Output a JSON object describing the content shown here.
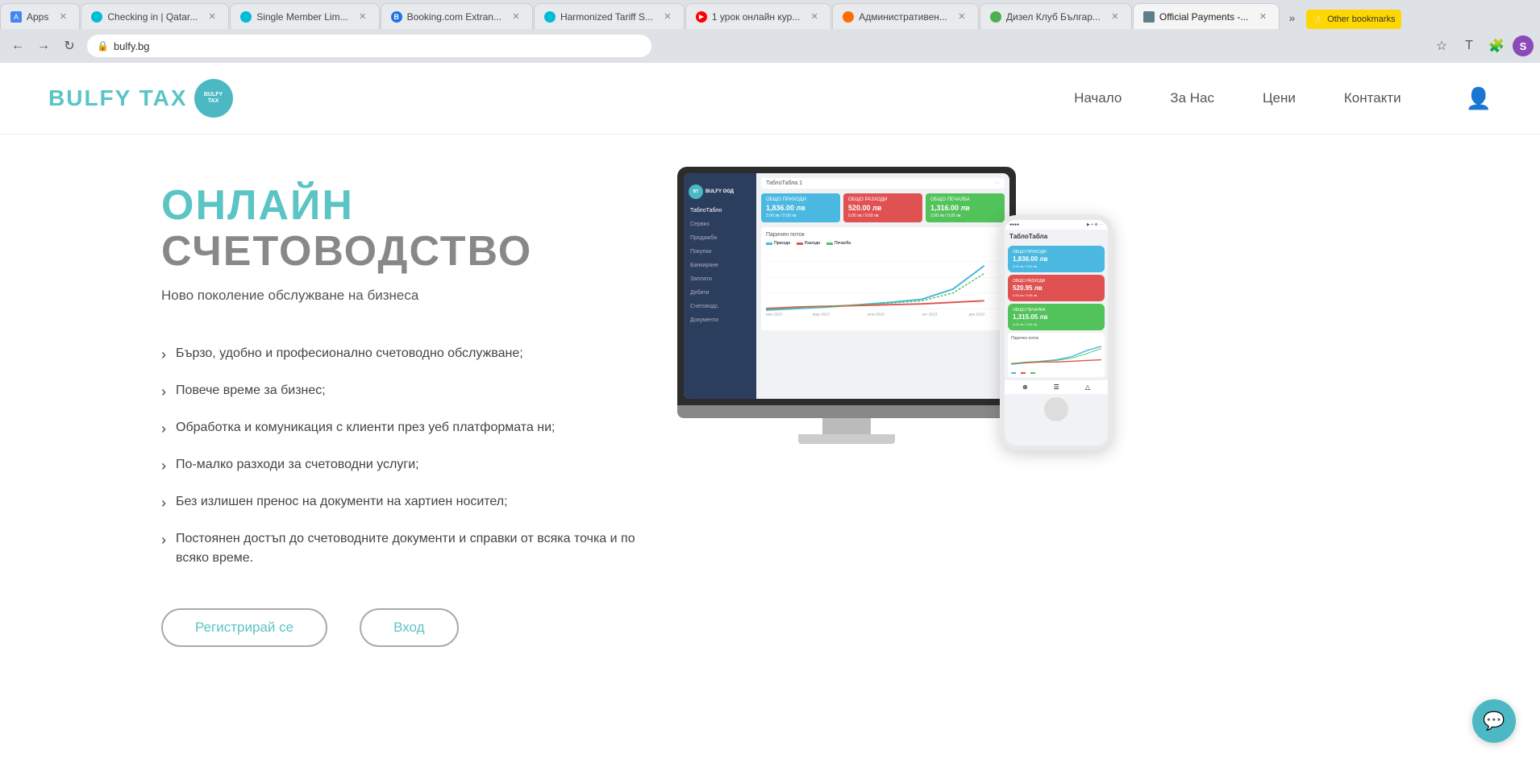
{
  "browser": {
    "url": "bulfy.bg",
    "nav": {
      "back": "←",
      "forward": "→",
      "reload": "↻"
    },
    "tabs": [
      {
        "id": "apps",
        "label": "Apps",
        "favicon": "apps",
        "active": false
      },
      {
        "id": "checking",
        "label": "Checking in | Qatar...",
        "favicon": "teal",
        "active": false
      },
      {
        "id": "single",
        "label": "Single Member Lim...",
        "favicon": "teal",
        "active": false
      },
      {
        "id": "booking",
        "label": "Booking.com Extran...",
        "favicon": "blue-b",
        "active": false
      },
      {
        "id": "harmonized",
        "label": "Harmonized Tariff S...",
        "favicon": "teal2",
        "active": false
      },
      {
        "id": "youtube",
        "label": "1 урок онлайн кур...",
        "favicon": "red-yt",
        "active": false
      },
      {
        "id": "admin",
        "label": "Административен...",
        "favicon": "orange",
        "active": false
      },
      {
        "id": "diesel",
        "label": "Дизел Клуб Българ...",
        "favicon": "green",
        "active": false
      },
      {
        "id": "official",
        "label": "Official Payments -...",
        "favicon": "gray",
        "active": true
      }
    ],
    "more_tabs": "»",
    "bookmarks_label": "Other bookmarks",
    "right_icons": {
      "star": "☆",
      "translate": "T",
      "puzzle": "🧩",
      "profile_letter": "S"
    }
  },
  "site": {
    "logo": {
      "text_gray": "BULFY",
      "text_teal": "TAX",
      "icon_line1": "BULFY",
      "icon_line2": "TAX"
    },
    "nav": {
      "items": [
        {
          "id": "home",
          "label": "Начало"
        },
        {
          "id": "about",
          "label": "За Нас"
        },
        {
          "id": "prices",
          "label": "Цени"
        },
        {
          "id": "contacts",
          "label": "Контакти"
        }
      ],
      "user_icon": "👤"
    },
    "hero": {
      "title_word1": "ОНЛАЙН",
      "title_word2": "СЧЕТОВОДСТВО",
      "subtitle": "Ново поколение обслужване на бизнеса",
      "features": [
        "Бързо, удобно и професионално счетоводно обслужване;",
        "Повече време за бизнес;",
        "Обработка и комуникация с клиенти през уеб платформата ни;",
        "По-малко разходи за счетоводни услуги;",
        "Без излишен пренос на документи на хартиен носител;",
        "Постоянен достъп до счетоводните документи и справки от всяка точка и по всяко време."
      ],
      "cta_register": "Регистрирай се",
      "cta_login": "Вход"
    },
    "mockup": {
      "sidebar_items": [
        "ТаблоТабло",
        "Сервиз",
        "Продажби",
        "Покупки",
        "Банкиране",
        "Заплати",
        "Дебити",
        "Счетоводс.",
        "Документи"
      ],
      "logo_text": "BULFY ООД",
      "tab_title": "ТаблоТабла 1",
      "card1_title": "ОБЩО ПРИХОДИ",
      "card1_value": "1,836.00 лв",
      "card1_sub": "3.00 лв / 0.00 лв",
      "card2_title": "ОБЩО РАЗХОДИ",
      "card2_value": "520.00 лв",
      "card2_sub": "0.00 лв / 0.00 лв",
      "card3_title": "ОБЩО ПЕЧАЛБА",
      "card3_value": "1,316.00 лв",
      "card3_sub": "3.00 лв / 0.00 лв",
      "chart_title": "Паричен поток",
      "phone_title": "ТаблоТабла",
      "phone_card1_title": "ОБЩО ПРИХОДИ",
      "phone_card1_value": "1,836.00 лв",
      "phone_card2_title": "ОБЩО РАЗХОДИ",
      "phone_card2_value": "520.95 лв",
      "phone_card3_title": "ОБЩО ПЕЧАЛБА",
      "phone_card3_value": "1,315.05 лв"
    }
  },
  "chat": {
    "icon": "💬"
  }
}
